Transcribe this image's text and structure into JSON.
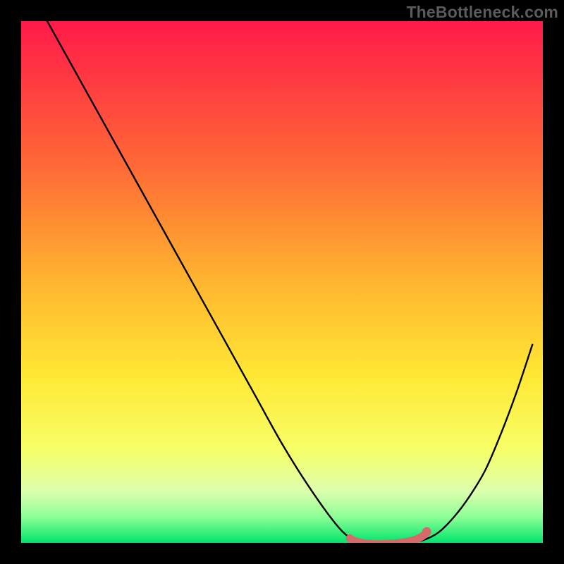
{
  "watermark": "TheBottleneck.com",
  "chart_data": {
    "type": "line",
    "title": "",
    "xlabel": "",
    "ylabel": "",
    "xlim": [
      0,
      100
    ],
    "ylim": [
      0,
      100
    ],
    "grid": false,
    "legend": false,
    "background_gradient": {
      "top": "#ff1a49",
      "mid_upper": "#ff8f32",
      "mid": "#ffe834",
      "mid_lower": "#f6ff6c",
      "near_bottom": "#9cff8f",
      "bottom": "#00e56b"
    },
    "series": [
      {
        "name": "bottleneck-curve",
        "color": "#000000",
        "x": [
          5,
          10,
          15,
          20,
          25,
          30,
          35,
          40,
          45,
          50,
          55,
          60,
          63,
          66,
          70,
          74,
          77,
          80,
          83,
          86,
          89,
          92,
          95,
          98
        ],
        "values": [
          100,
          91,
          82,
          73,
          64,
          55,
          46,
          37,
          28,
          19,
          11,
          4,
          1,
          0,
          0,
          0,
          0.5,
          2,
          5,
          9,
          14,
          21,
          29,
          38
        ]
      }
    ],
    "highlight": {
      "name": "optimal-zone",
      "color": "#d66a6a",
      "x_start": 63,
      "x_end": 78,
      "y": 0.5
    }
  }
}
